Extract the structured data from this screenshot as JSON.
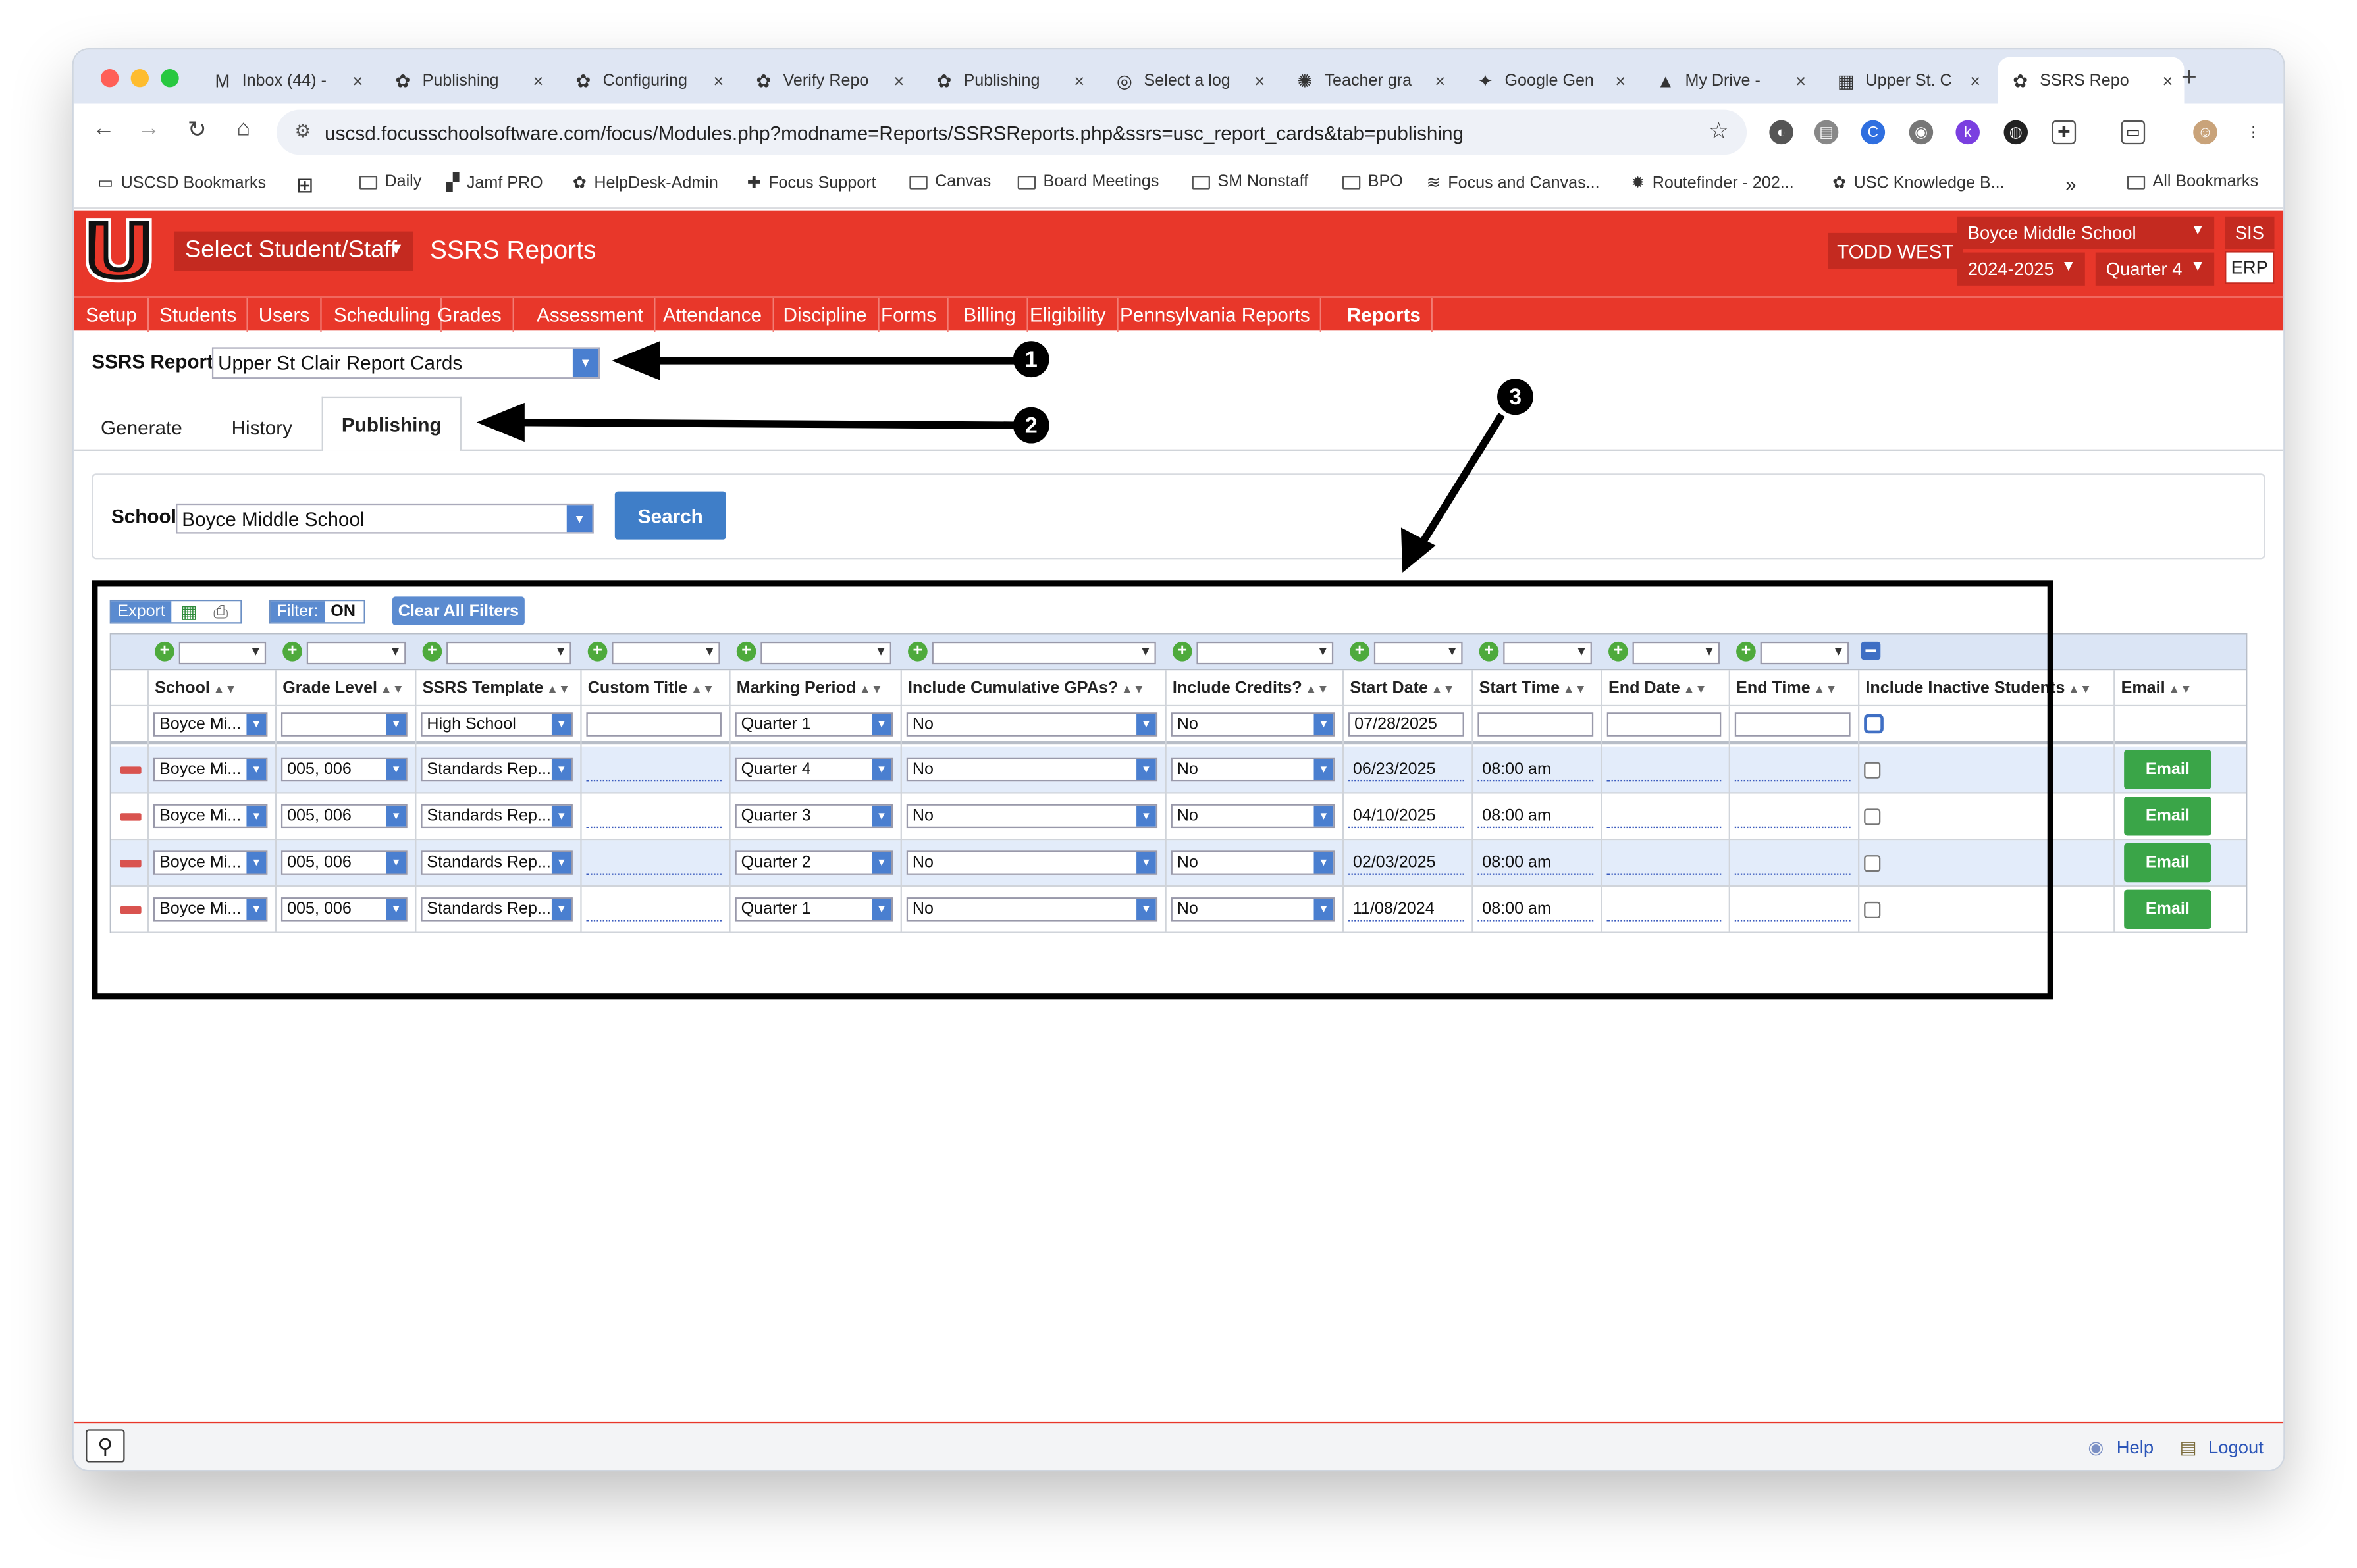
{
  "browser": {
    "tabs": [
      {
        "label": "Inbox (44) -",
        "icon": "gmail-icon"
      },
      {
        "label": "Publishing",
        "icon": "paw-icon"
      },
      {
        "label": "Configuring",
        "icon": "paw-icon"
      },
      {
        "label": "Verify Repo",
        "icon": "paw-icon"
      },
      {
        "label": "Publishing",
        "icon": "paw-icon"
      },
      {
        "label": "Select a log",
        "icon": "globe-icon"
      },
      {
        "label": "Teacher gra",
        "icon": "openai-icon"
      },
      {
        "label": "Google Gen",
        "icon": "gemini-icon"
      },
      {
        "label": "My Drive -",
        "icon": "drive-icon"
      },
      {
        "label": "Upper St. C",
        "icon": "calendar-icon"
      },
      {
        "label": "SSRS Repo",
        "icon": "reports-icon"
      }
    ],
    "url": "uscsd.focusschoolsoftware.com/focus/Modules.php?modname=Reports/SSRSReports.php&ssrs=usc_report_cards&tab=publishing",
    "bookmarks": [
      "USCSD Bookmarks",
      "Daily",
      "Jamf PRO",
      "HelpDesk-Admin",
      "Focus Support",
      "Canvas",
      "Board Meetings",
      "SM Nonstaff",
      "BPO",
      "Focus and Canvas...",
      "Routefinder - 202...",
      "USC Knowledge B...",
      "All Bookmarks"
    ],
    "more": "»"
  },
  "header": {
    "select_student": "Select Student/Staff",
    "title": "SSRS Reports",
    "user": "TODD WEST",
    "school": "Boyce Middle School",
    "year": "2024-2025",
    "quarter": "Quarter 4",
    "sis": "SIS",
    "erp": "ERP"
  },
  "menu": [
    "Setup",
    "Students",
    "Users",
    "Scheduling",
    "Grades",
    "Assessment",
    "Attendance",
    "Discipline",
    "Forms",
    "Billing",
    "Eligibility",
    "Pennsylvania Reports",
    "Reports"
  ],
  "ssrs": {
    "label": "SSRS Report:",
    "value": "Upper St Clair Report Cards"
  },
  "page_tabs": [
    "Generate",
    "History",
    "Publishing"
  ],
  "school_filter": {
    "label": "School:",
    "value": "Boyce Middle School",
    "search": "Search"
  },
  "toolbar": {
    "export": "Export",
    "filter": "Filter:",
    "filter_state": "ON",
    "clear": "Clear All Filters"
  },
  "columns": [
    "School",
    "Grade Level",
    "SSRS Template",
    "Custom Title",
    "Marking Period",
    "Include Cumulative GPAs?",
    "Include Credits?",
    "Start Date",
    "Start Time",
    "End Date",
    "End Time",
    "Include Inactive Students",
    "Email"
  ],
  "new_row": {
    "school": "Boyce Mi...",
    "grade": "",
    "template": "High School",
    "title": "",
    "mp": "Quarter 1",
    "gpa": "No",
    "credits": "No",
    "start_date": "07/28/2025",
    "start_time": "",
    "end_date": "",
    "end_time": ""
  },
  "rows": [
    {
      "school": "Boyce Mi...",
      "grade": "005, 006",
      "template": "Standards Rep...",
      "mp": "Quarter 4",
      "gpa": "No",
      "credits": "No",
      "start_date": "06/23/2025",
      "start_time": "08:00 am",
      "email": "Email"
    },
    {
      "school": "Boyce Mi...",
      "grade": "005, 006",
      "template": "Standards Rep...",
      "mp": "Quarter 3",
      "gpa": "No",
      "credits": "No",
      "start_date": "04/10/2025",
      "start_time": "08:00 am",
      "email": "Email"
    },
    {
      "school": "Boyce Mi...",
      "grade": "005, 006",
      "template": "Standards Rep...",
      "mp": "Quarter 2",
      "gpa": "No",
      "credits": "No",
      "start_date": "02/03/2025",
      "start_time": "08:00 am",
      "email": "Email"
    },
    {
      "school": "Boyce Mi...",
      "grade": "005, 006",
      "template": "Standards Rep...",
      "mp": "Quarter 1",
      "gpa": "No",
      "credits": "No",
      "start_date": "11/08/2024",
      "start_time": "08:00 am",
      "email": "Email"
    }
  ],
  "annotations": [
    "1",
    "2",
    "3"
  ],
  "footer": {
    "help": "Help",
    "logout": "Logout"
  },
  "colors": {
    "brand_red": "#e8372a",
    "blue": "#4a7fd0",
    "green": "#3aa548"
  }
}
